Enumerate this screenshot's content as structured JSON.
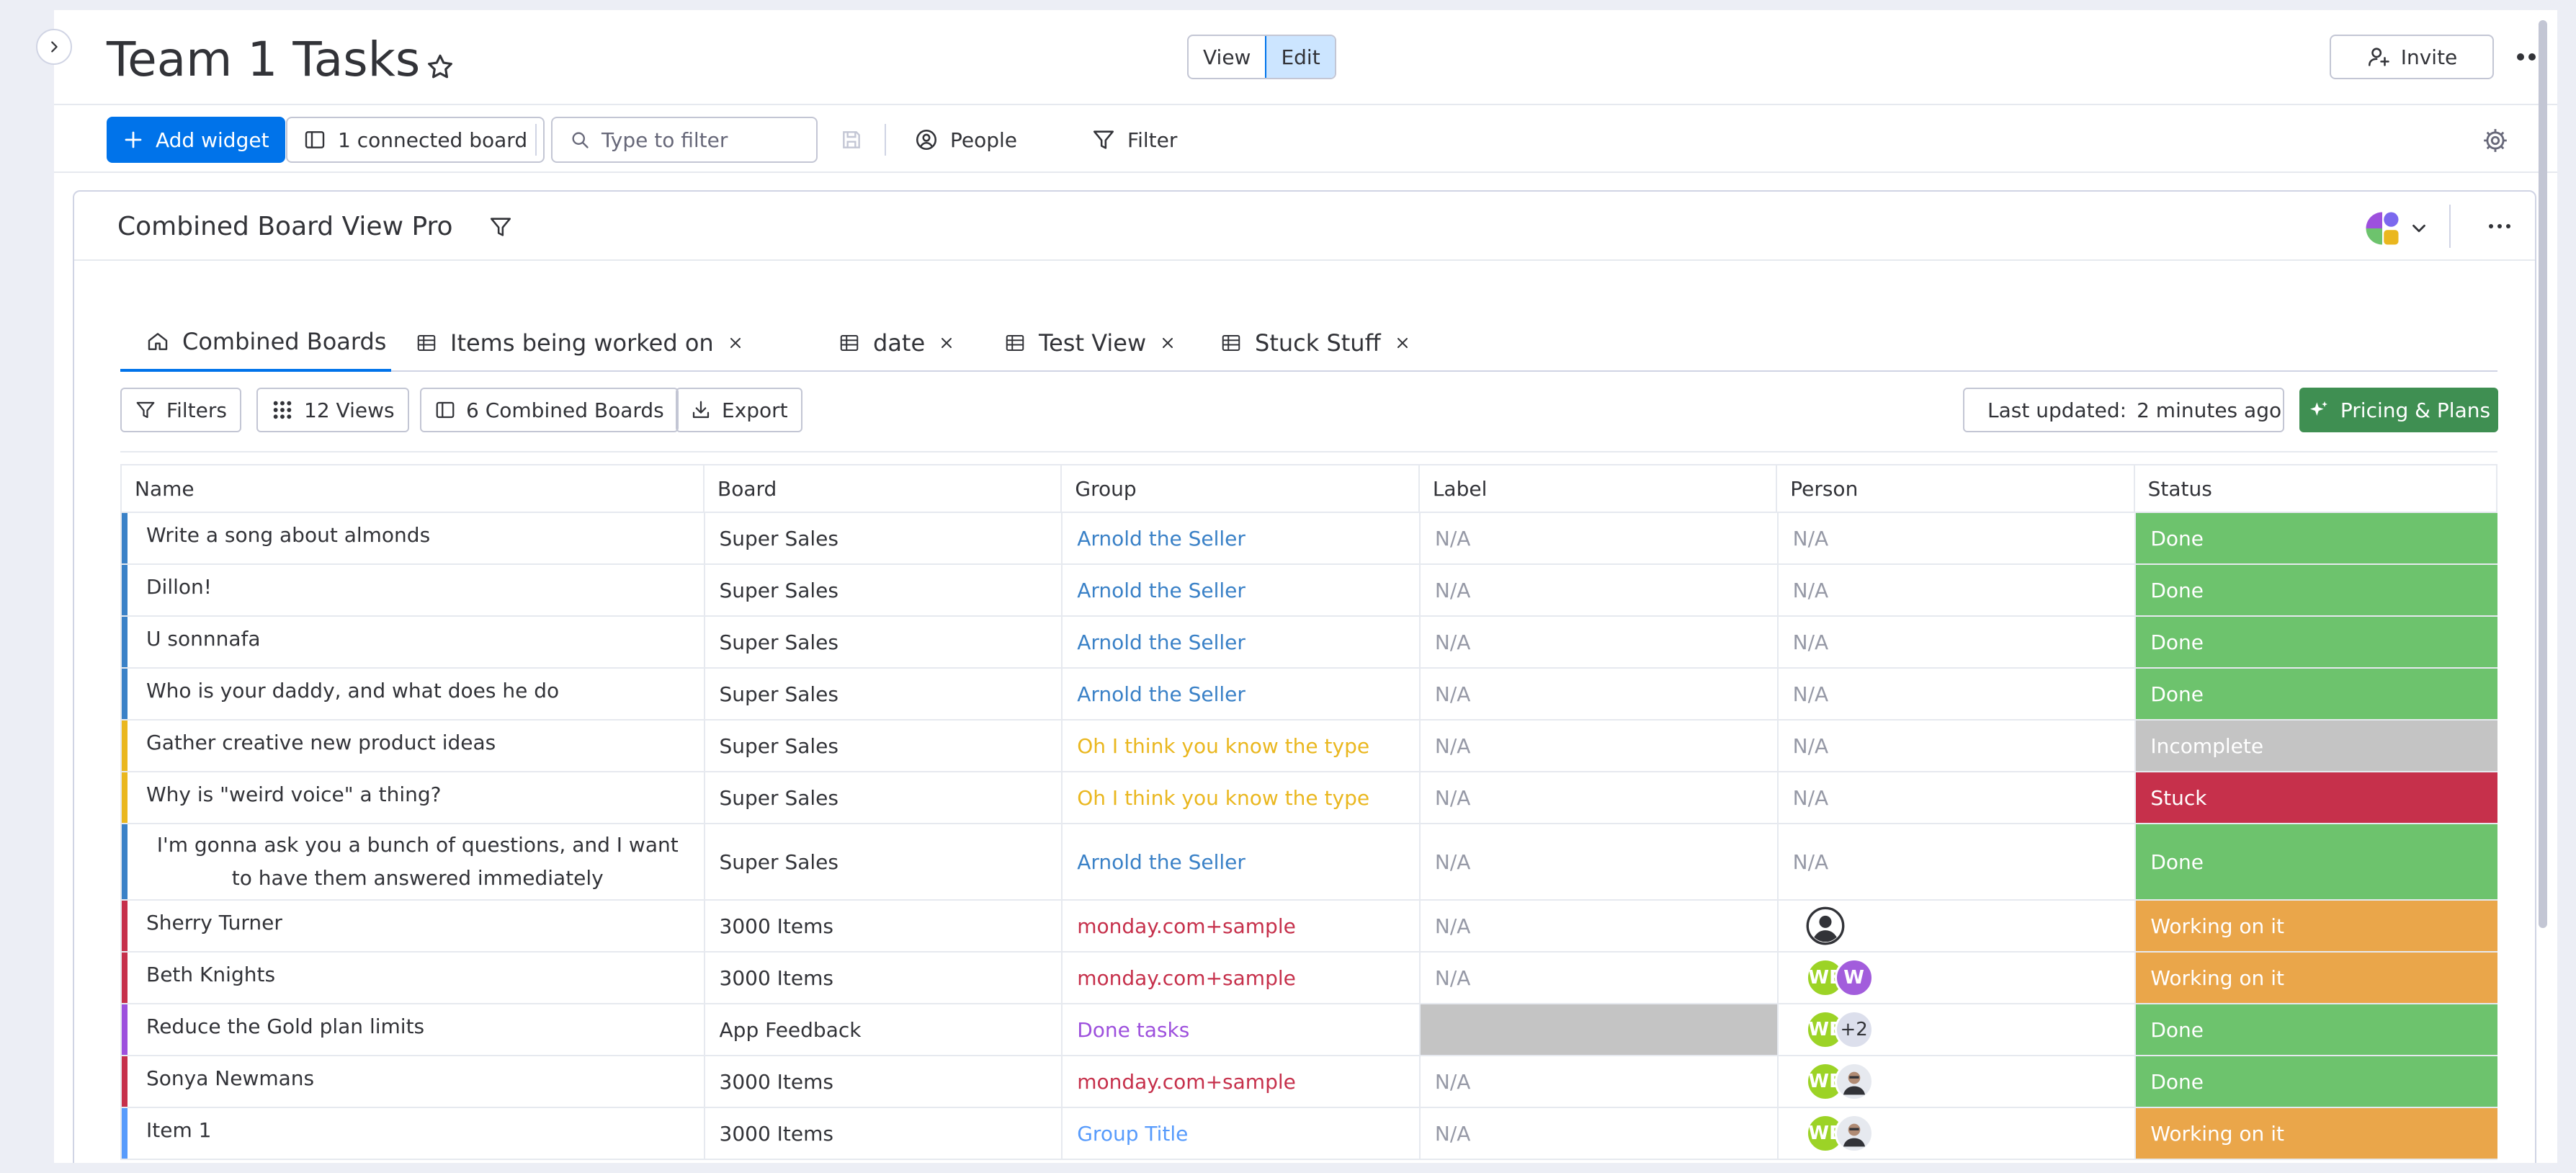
{
  "header": {
    "title": "Team 1 Tasks",
    "view_label": "View",
    "edit_label": "Edit",
    "invite_label": "Invite"
  },
  "toolbar": {
    "add_widget_label": "Add widget",
    "connected_board_label": "1 connected board",
    "filter_placeholder": "Type to filter",
    "people_label": "People",
    "filter_label": "Filter"
  },
  "widget": {
    "title": "Combined Board View Pro",
    "tabs": [
      {
        "label": "Combined Boards",
        "icon": "home-icon",
        "closable": false,
        "active": true
      },
      {
        "label": "Items being worked on",
        "icon": "table-icon",
        "closable": true
      },
      {
        "label": "date",
        "icon": "table-icon",
        "closable": true
      },
      {
        "label": "Test View",
        "icon": "table-icon",
        "closable": true
      },
      {
        "label": "Stuck Stuff",
        "icon": "table-icon",
        "closable": true
      }
    ],
    "filters_label": "Filters",
    "views_label": "12 Views",
    "combined_boards_label": "6 Combined Boards",
    "export_label": "Export",
    "last_updated_label": "Last updated:",
    "last_updated_value": "2 minutes ago",
    "pricing_label": "Pricing & Plans"
  },
  "table": {
    "columns": [
      "Name",
      "Board",
      "Group",
      "Label",
      "Person",
      "Status"
    ],
    "rows": [
      {
        "name": "Write a song about almonds",
        "board": "Super Sales",
        "group": "Arnold the Seller",
        "label": "N/A",
        "person": "N/A",
        "status": "Done"
      },
      {
        "name": "Dillon!",
        "board": "Super Sales",
        "group": "Arnold the Seller",
        "label": "N/A",
        "person": "N/A",
        "status": "Done"
      },
      {
        "name": "U sonnnafa",
        "board": "Super Sales",
        "group": "Arnold the Seller",
        "label": "N/A",
        "person": "N/A",
        "status": "Done"
      },
      {
        "name": "Who is your daddy, and what does he do",
        "board": "Super Sales",
        "group": "Arnold the Seller",
        "label": "N/A",
        "person": "N/A",
        "status": "Done"
      },
      {
        "name": "Gather creative new product ideas",
        "board": "Super Sales",
        "group": "Oh I think you know the type",
        "label": "N/A",
        "person": "N/A",
        "status": "Incomplete"
      },
      {
        "name": "Why is \"weird voice\" a thing?",
        "board": "Super Sales",
        "group": "Oh I think you know the type",
        "label": "N/A",
        "person": "N/A",
        "status": "Stuck"
      },
      {
        "name": "I'm gonna ask you a bunch of questions, and I want to have them answered immediately",
        "board": "Super Sales",
        "group": "Arnold the Seller",
        "label": "N/A",
        "person": "N/A",
        "status": "Done"
      },
      {
        "name": "Sherry Turner",
        "board": "3000 Items",
        "group": "monday.com+sample",
        "label": "N/A",
        "person": "",
        "status": "Working on it"
      },
      {
        "name": "Beth Knights",
        "board": "3000 Items",
        "group": "monday.com+sample",
        "label": "N/A",
        "person": "",
        "status": "Working on it"
      },
      {
        "name": "Reduce the Gold plan limits",
        "board": "App Feedback",
        "group": "Done tasks",
        "label": "",
        "person": "",
        "status": "Done"
      },
      {
        "name": "Sonya Newmans",
        "board": "3000 Items",
        "group": "monday.com+sample",
        "label": "N/A",
        "person": "",
        "status": "Done"
      },
      {
        "name": "Item 1",
        "board": "3000 Items",
        "group": "Group Title",
        "label": "N/A",
        "person": "",
        "status": "Working on it"
      }
    ],
    "avatars": {
      "w_letter": "W",
      "we_letters": "WE",
      "more_count": "+2"
    }
  },
  "colors": {
    "primary": "#0073ea",
    "done": "#6dc36d",
    "stuck": "#c6304b",
    "working": "#eaa64a",
    "incomplete": "#c4c4c4",
    "blue_group": "#3a81c7",
    "yellow_group": "#eab71f",
    "red_group": "#c6304b",
    "purple_group": "#9d50dd",
    "pricing": "#3f8f52"
  }
}
